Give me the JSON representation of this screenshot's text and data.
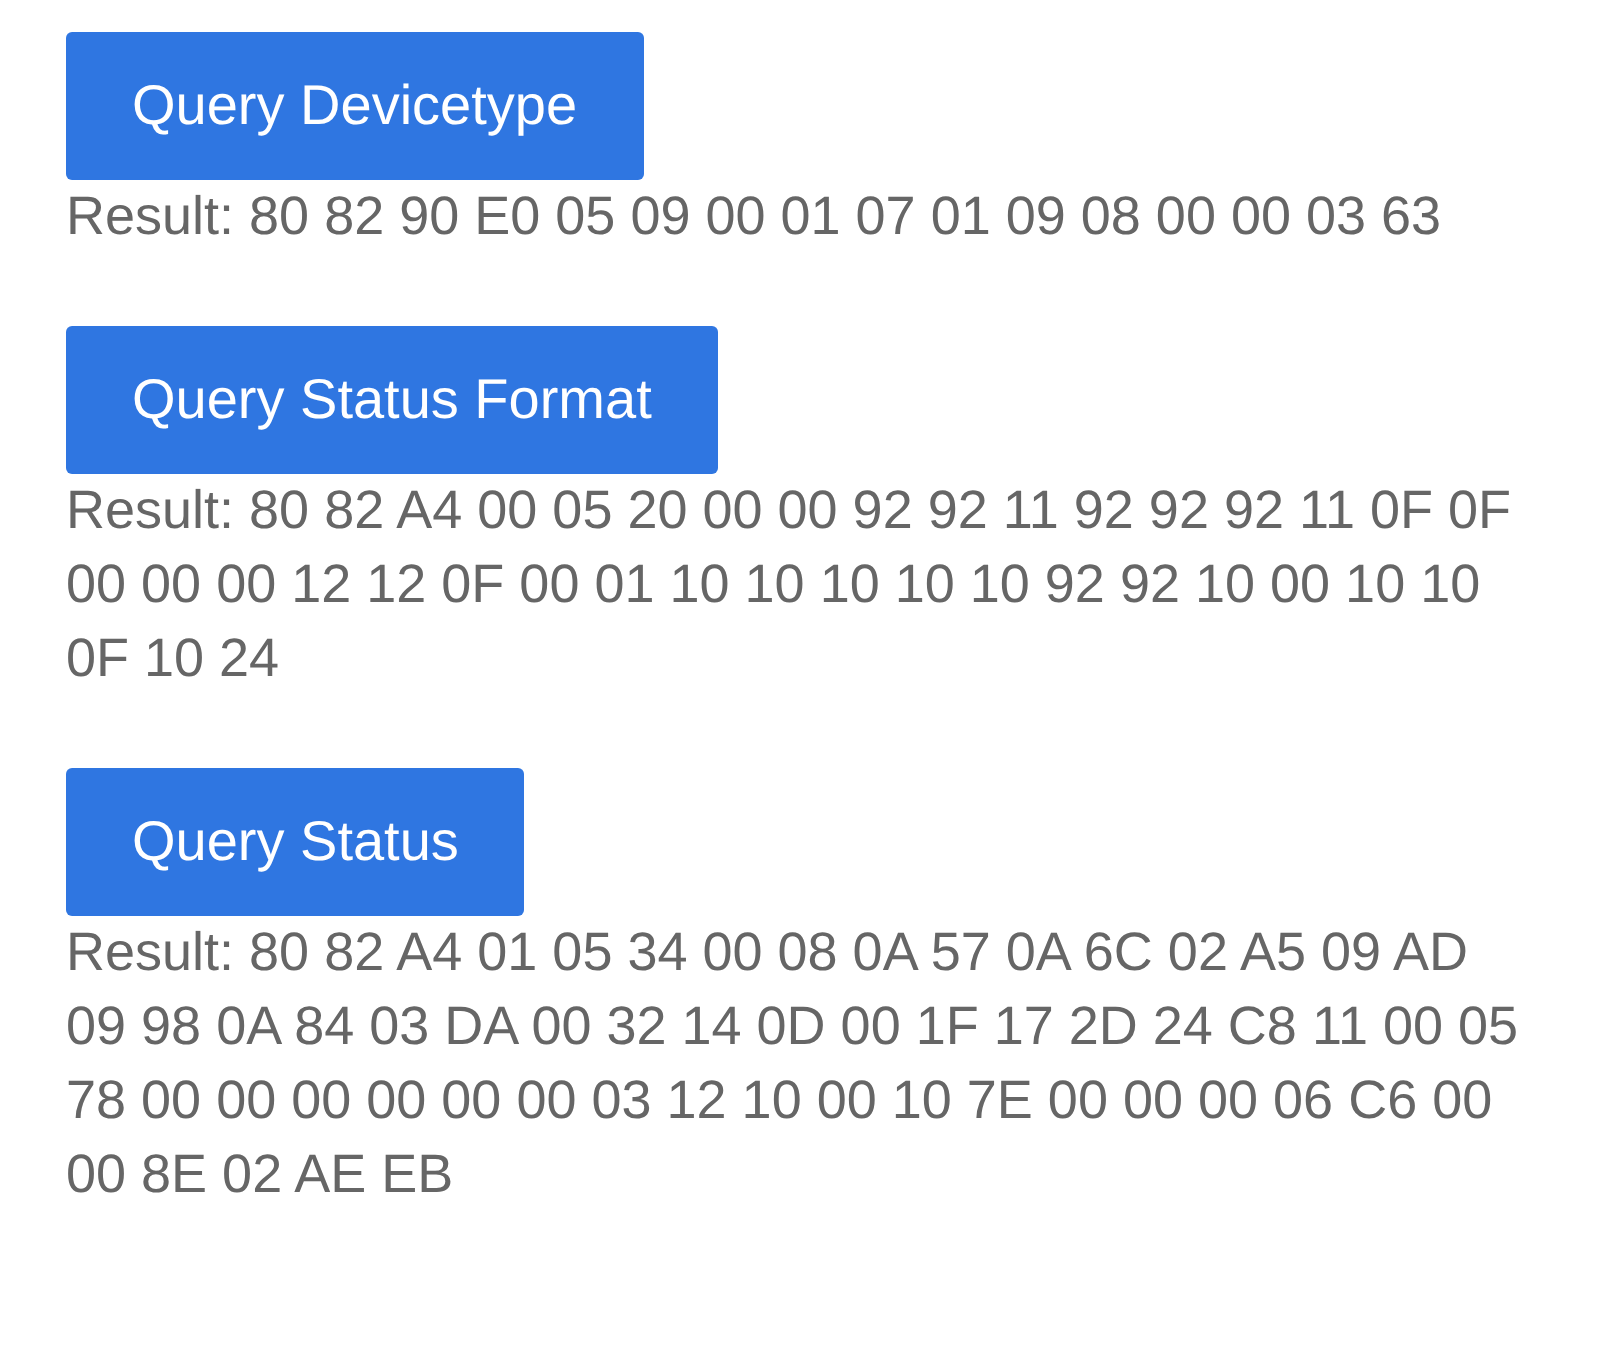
{
  "queries": [
    {
      "button": "Query Devicetype",
      "result": "Result: 80 82 90 E0 05 09 00 01 07 01 09 08 00 00 03 63"
    },
    {
      "button": "Query Status Format",
      "result": "Result: 80 82 A4 00 05 20 00 00 92 92 11 92 92 92 11 0F 0F 00 00 00 12 12 0F 00 01 10 10 10 10 10 92 92 10 00 10 10 0F 10 24"
    },
    {
      "button": "Query Status",
      "result": "Result: 80 82 A4 01 05 34 00 08 0A 57 0A 6C 02 A5 09 AD 09 98 0A 84 03 DA 00 32 14 0D 00 1F 17 2D 24 C8 11 00 05 78 00 00 00 00 00 00 03 12 10 00 10 7E 00 00 00 06 C6 00 00 8E 02 AE EB"
    }
  ]
}
